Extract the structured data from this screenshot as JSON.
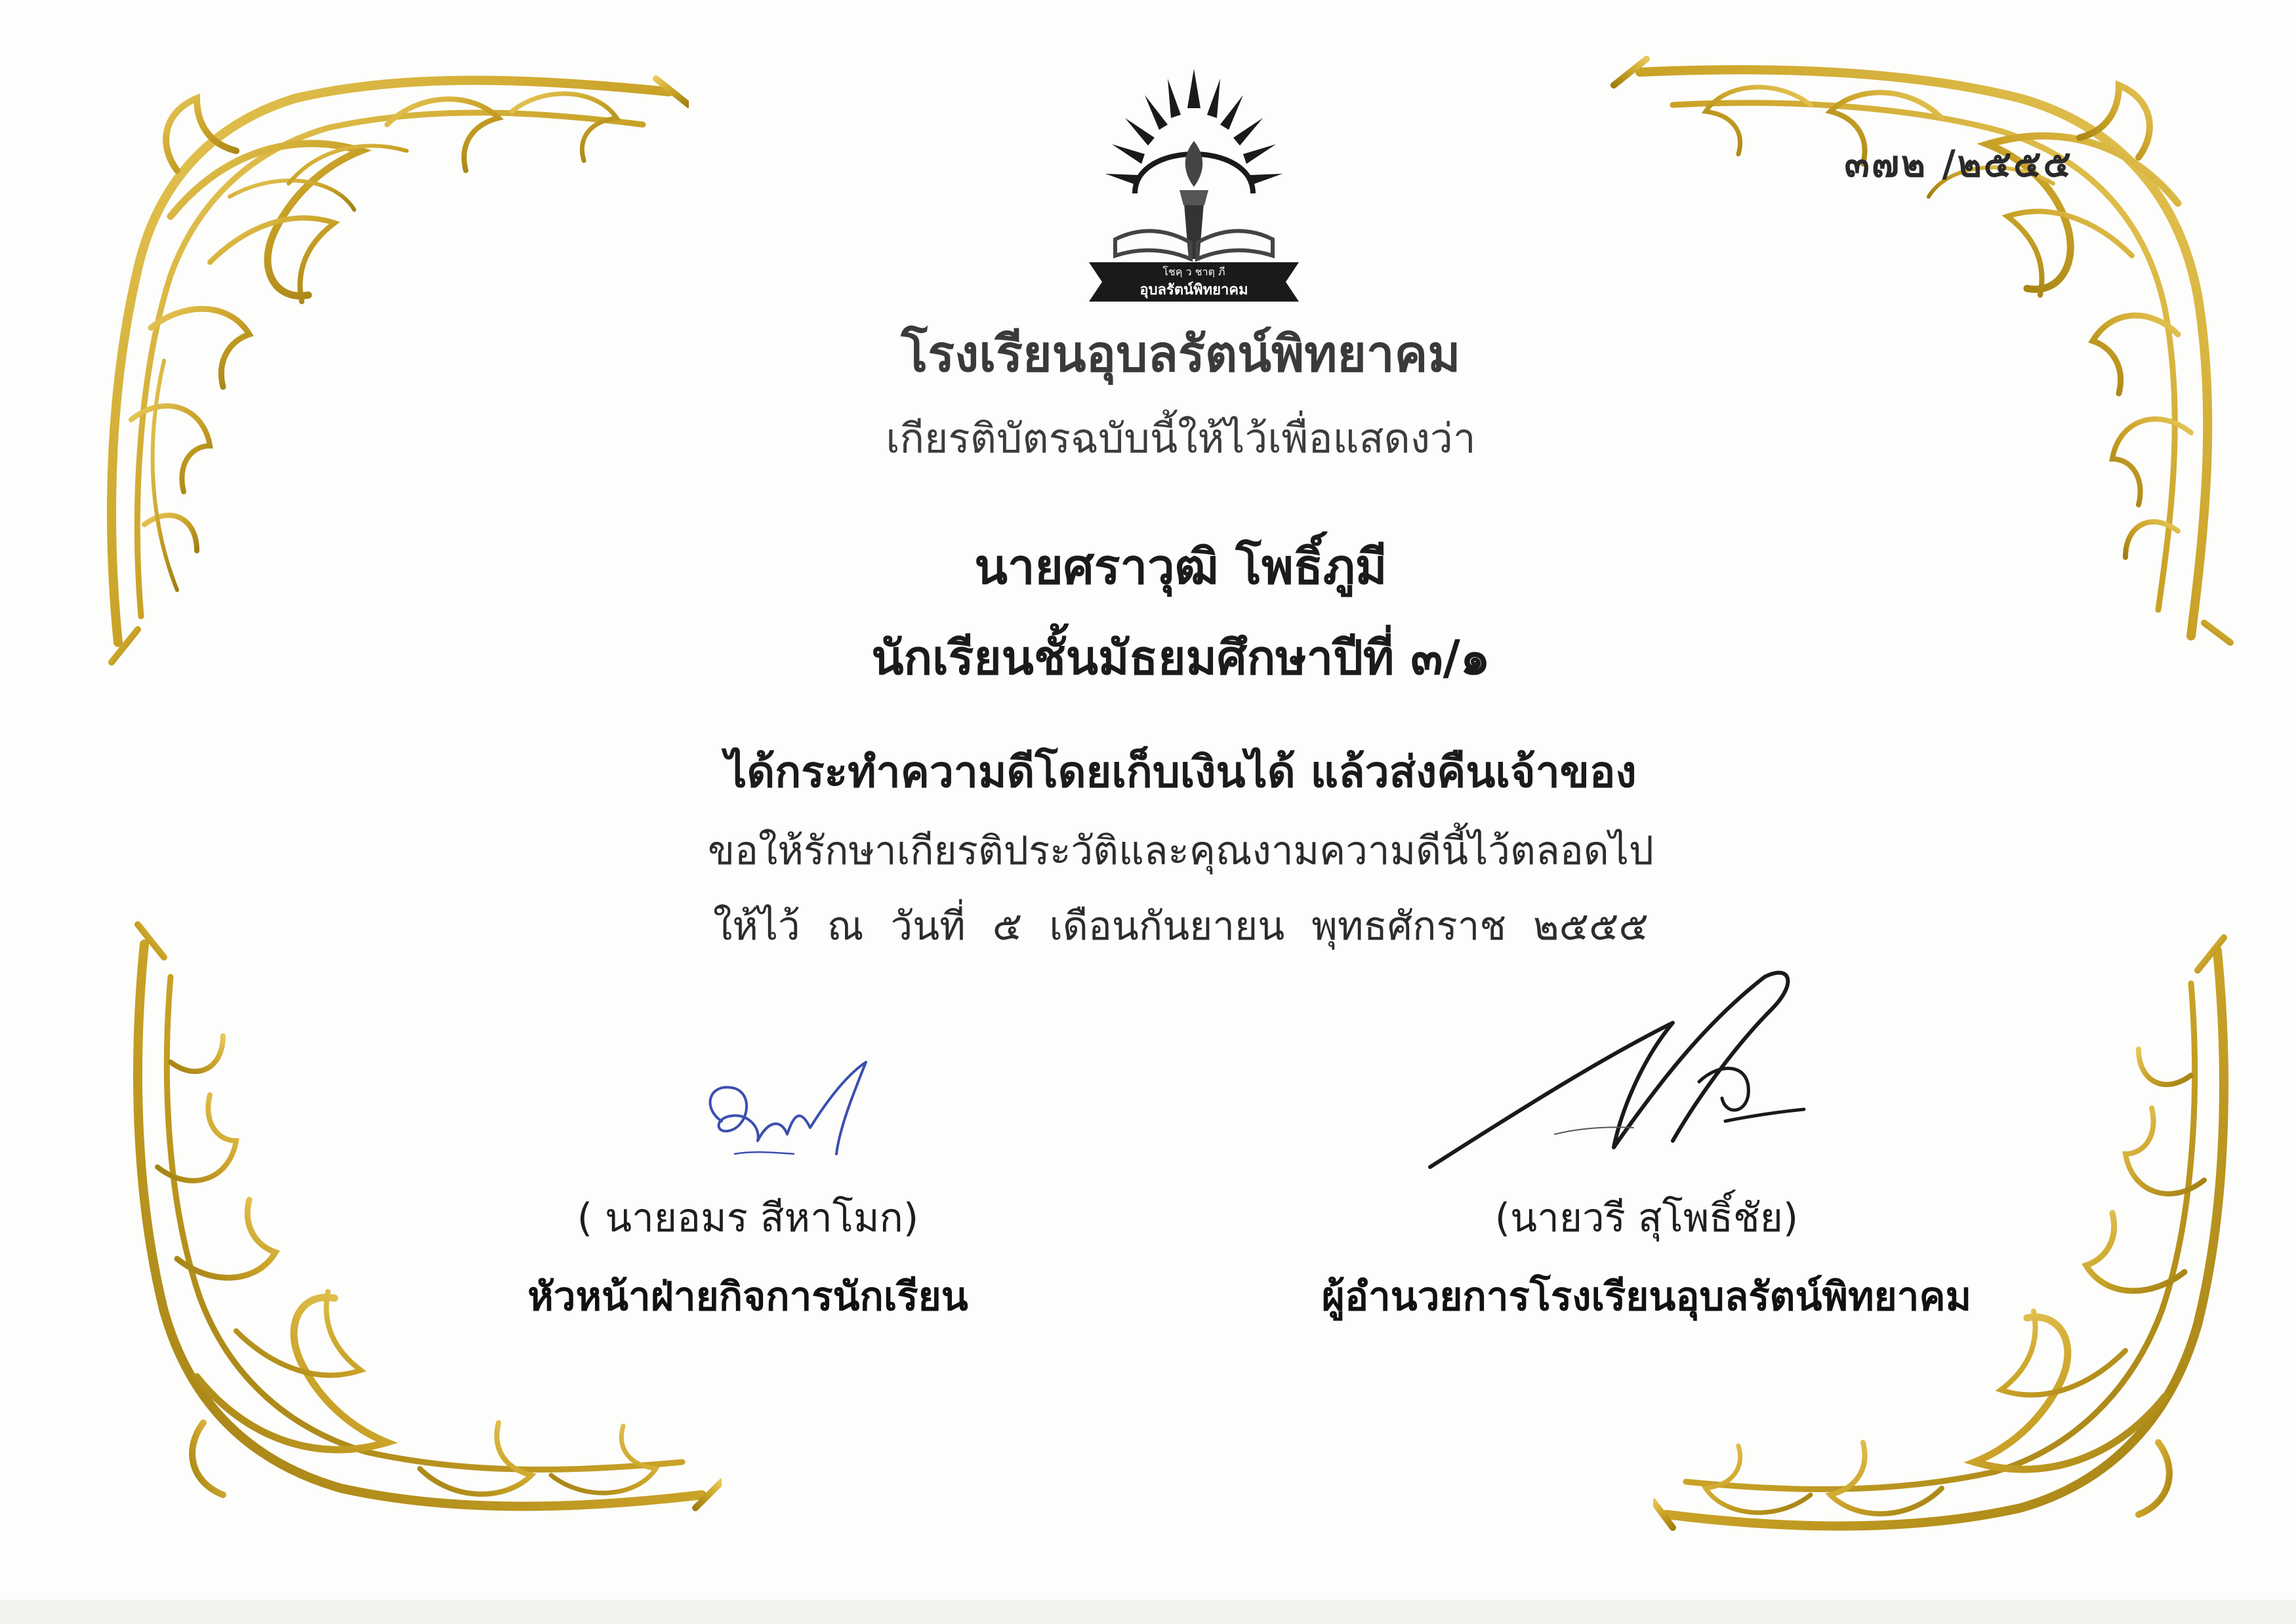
{
  "certificate": {
    "number": "๓๗๒ /๒๕๕๕",
    "school_name": "โรงเรียนอุบลรัตน์พิทยาคม",
    "intro": "เกียรติบัตรฉบับนี้ให้ไว้เพื่อแสดงว่า",
    "recipient_name": "นายศราวุฒิ  โพธิ์ภูมี",
    "recipient_class": "นักเรียนชั้นมัธยมศึกษาปีที่ ๓/๑",
    "deed": "ได้กระทำความดีโดยเก็บเงินได้ แล้วส่งคืนเจ้าของ",
    "blessing": "ขอให้รักษาเกียรติประวัติและคุณงามความดีนี้ไว้ตลอดไป",
    "date_line": "ให้ไว้ ณ วันที่ ๕ เดือนกันยายน พุทธศักราช ๒๕๕๕"
  },
  "emblem": {
    "motto": "โชคฺ ว ชาตฺ ภี",
    "banner": "อุบลรัตน์พิทยาคม"
  },
  "signers": {
    "left": {
      "name": "( นายอมร  สีหาโมก)",
      "title": "หัวหน้าฝ่ายกิจการนักเรียน",
      "signature_ink": "#3b4fb0"
    },
    "right": {
      "name": "(นายวรี  สุโพธิ์ชัย)",
      "title": "ผู้อำนวยการโรงเรียนอุบลรัตน์พิทยาคม",
      "signature_ink": "#1a1a1a"
    }
  },
  "colors": {
    "ornament_gold": "#c9a227",
    "ornament_gold_dark": "#a07e12",
    "ornament_gold_light": "#e8c85a",
    "text": "#1b1b1b",
    "paper": "#fdfdfb"
  },
  "icons": [
    "gold-corner-ornament",
    "school-emblem-torch-icon",
    "signature"
  ]
}
